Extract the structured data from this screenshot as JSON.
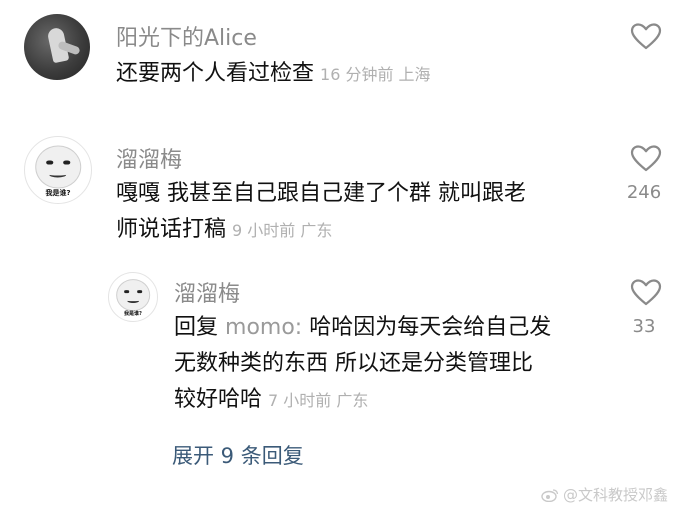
{
  "comments": [
    {
      "username": "阳光下的Alice",
      "text_lines": [
        "还要两个人看过检查"
      ],
      "meta": "16 分钟前 上海",
      "likes": ""
    },
    {
      "username": "溜溜梅",
      "avatar_caption": "我是谁?",
      "text_lines": [
        "嘎嘎 我甚至自己跟自己建了个群 就叫跟老",
        "师说话打稿"
      ],
      "meta": "9 小时前 广东",
      "likes": "246"
    }
  ],
  "reply": {
    "username": "溜溜梅",
    "avatar_caption": "我是谁?",
    "prefix": "回复",
    "target": "momo:",
    "text_lines": [
      " 哈哈因为每天会给自己发",
      "无数种类的东西 所以还是分类管理比",
      "较好哈哈"
    ],
    "meta": "7 小时前 广东",
    "likes": "33"
  },
  "expand_label": "展开 9 条回复",
  "watermark": "@文科教授邓鑫",
  "colors": {
    "name": "#8a8a8a",
    "meta": "#b0b0b0",
    "link": "#3b5a78",
    "text": "#111111"
  }
}
